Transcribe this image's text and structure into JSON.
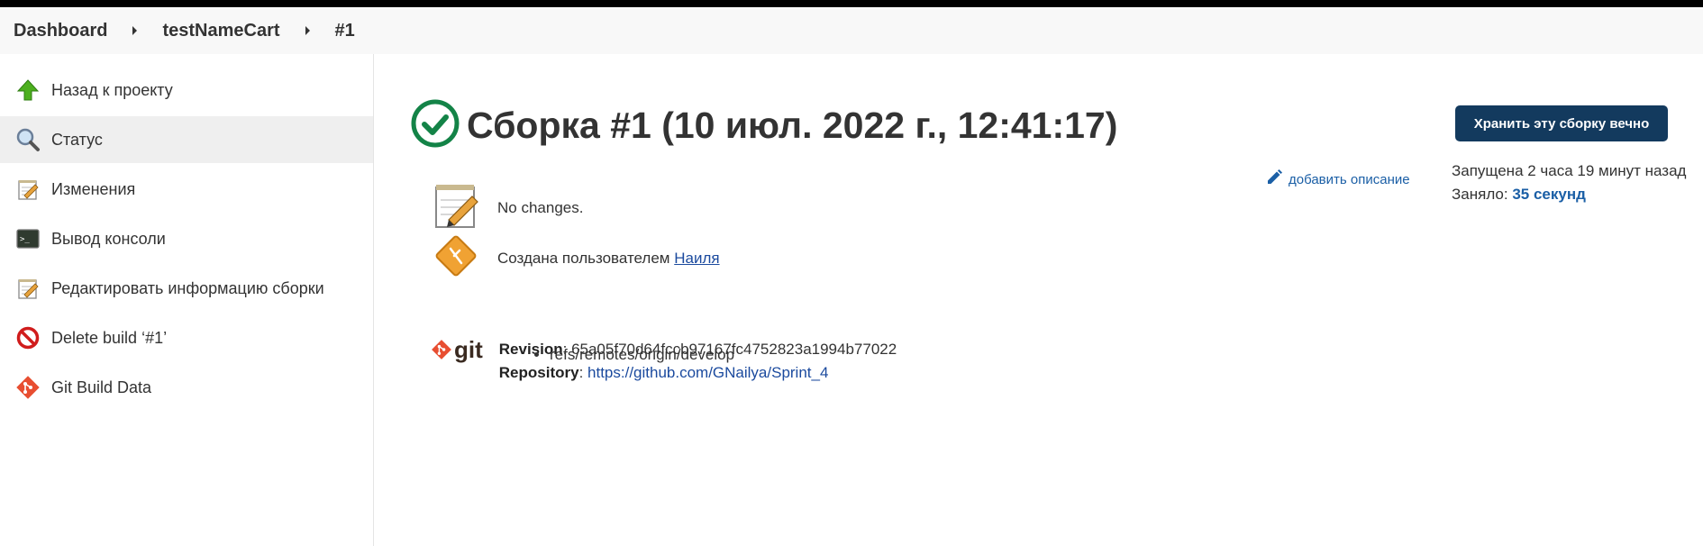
{
  "breadcrumbs": [
    "Dashboard",
    "testNameCart",
    "#1"
  ],
  "sidebar": {
    "items": [
      {
        "label": "Назад к проекту",
        "icon": "up-arrow-icon"
      },
      {
        "label": "Статус",
        "icon": "magnifier-icon",
        "active": true
      },
      {
        "label": "Изменения",
        "icon": "notepad-icon"
      },
      {
        "label": "Вывод консоли",
        "icon": "terminal-icon"
      },
      {
        "label": "Редактировать информацию сборки",
        "icon": "notepad-icon"
      },
      {
        "label": "Delete build ‘#1’",
        "icon": "no-entry-icon"
      },
      {
        "label": "Git Build Data",
        "icon": "git-icon"
      }
    ]
  },
  "main": {
    "title": "Сборка #1 (10 июл. 2022 г., 12:41:17)",
    "keep_button": "Хранить эту сборку вечно",
    "started_text": "Запущена 2 часа 19 минут назад",
    "duration_label": "Заняло: ",
    "duration_value": "35 секунд",
    "add_description": "добавить описание",
    "no_changes": "No changes.",
    "created_by_label": "Создана пользователем ",
    "created_by_user": "Наиля",
    "revision_label": "Revision",
    "revision_value": ": 65a05f70d64fccb97167fc4752823a1994b77022",
    "repository_label": "Repository",
    "repository_sep": ": ",
    "repository_url": "https://github.com/GNailya/Sprint_4",
    "branches": [
      "refs/remotes/origin/develop"
    ],
    "git_logo_text": "git"
  },
  "colors": {
    "accent": "#133a5e",
    "success": "#138347",
    "link": "#1b5fa6"
  }
}
